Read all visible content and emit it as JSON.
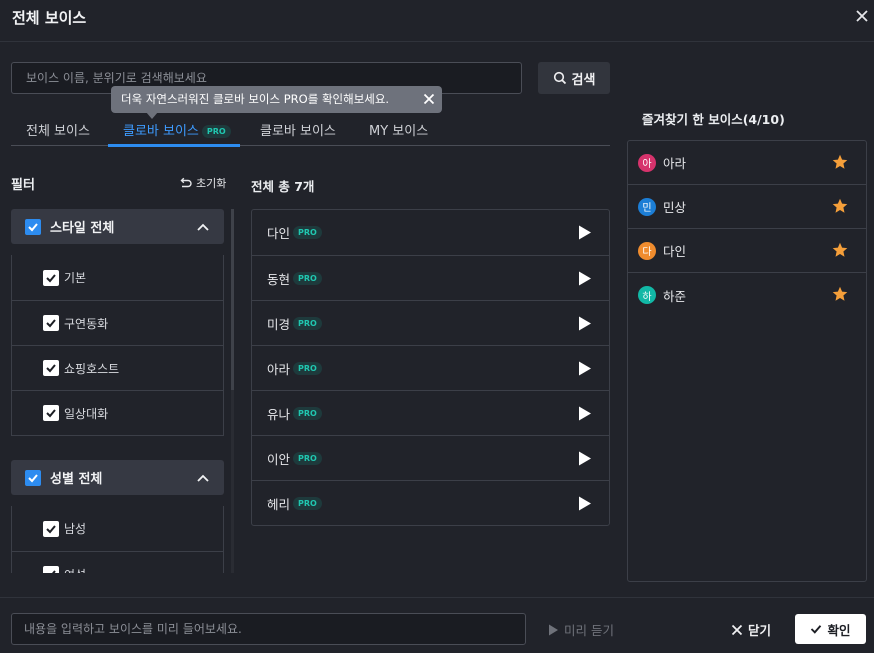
{
  "dialog": {
    "title": "전체 보이스"
  },
  "search": {
    "placeholder": "보이스 이름, 분위기로 검색해보세요",
    "button_label": "검색"
  },
  "tooltip": {
    "text": "더욱 자연스러워진 클로바 보이스 PRO를 확인해보세요."
  },
  "tabs": [
    {
      "label": "전체 보이스"
    },
    {
      "label": "클로바 보이스",
      "badge": "PRO",
      "active": true
    },
    {
      "label": "클로바 보이스"
    },
    {
      "label": "MY 보이스"
    }
  ],
  "filter": {
    "title": "필터",
    "reset_label": "초기화",
    "groups": [
      {
        "label": "스타일 전체",
        "options": [
          "기본",
          "구연동화",
          "쇼핑호스트",
          "일상대화"
        ]
      },
      {
        "label": "성별 전체",
        "options": [
          "남성",
          "여성"
        ]
      }
    ]
  },
  "voice_list": {
    "title": "전체 총 7개",
    "badge": "PRO",
    "voices": [
      "다인",
      "동현",
      "미경",
      "아라",
      "유나",
      "이안",
      "헤리"
    ]
  },
  "favorites": {
    "title": "즐겨찾기 한 보이스(4/10)",
    "items": [
      {
        "initial": "아",
        "name": "아라",
        "color": "#d6336c"
      },
      {
        "initial": "민",
        "name": "민상",
        "color": "#1c7ed6"
      },
      {
        "initial": "다",
        "name": "다인",
        "color": "#f08c2e"
      },
      {
        "initial": "하",
        "name": "하준",
        "color": "#12b8a6"
      }
    ],
    "star_color": "#f59f3a"
  },
  "footer": {
    "preview_placeholder": "내용을 입력하고 보이스를 미리 들어보세요.",
    "preview_label": "미리 듣기",
    "close_label": "닫기",
    "confirm_label": "확인"
  },
  "colors": {
    "accent": "#2d8cf0",
    "pro_badge": "#20c7b0"
  }
}
